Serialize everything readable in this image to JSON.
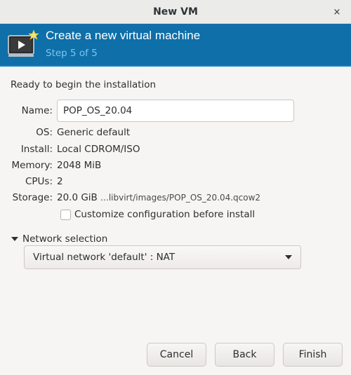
{
  "window": {
    "title": "New VM",
    "close_icon": "×"
  },
  "banner": {
    "icon": "vm-screen-icon",
    "heading": "Create a new virtual machine",
    "step": "Step 5 of 5"
  },
  "summary": {
    "ready_text": "Ready to begin the installation",
    "name_label": "Name:",
    "name_value": "POP_OS_20.04",
    "os_label": "OS:",
    "os_value": "Generic default",
    "install_label": "Install:",
    "install_value": "Local CDROM/ISO",
    "memory_label": "Memory:",
    "memory_value": "2048 MiB",
    "cpus_label": "CPUs:",
    "cpus_value": "2",
    "storage_label": "Storage:",
    "storage_size": "20.0 GiB",
    "storage_path": "…libvirt/images/POP_OS_20.04.qcow2",
    "customize_label": "Customize configuration before install",
    "customize_checked": false
  },
  "network": {
    "expander_label": "Network selection",
    "selected": "Virtual network 'default' : NAT"
  },
  "buttons": {
    "cancel": "Cancel",
    "back": "Back",
    "finish": "Finish"
  },
  "colors": {
    "banner_bg": "#0f6fa8",
    "step_text": "#7cc6f2"
  }
}
